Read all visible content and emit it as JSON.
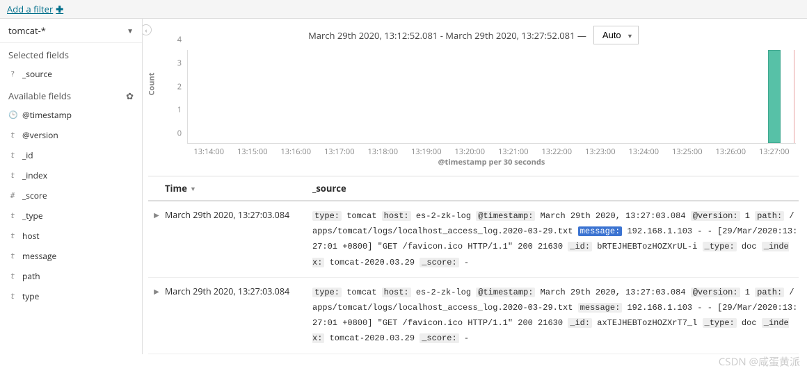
{
  "top": {
    "add_filter": "Add a filter"
  },
  "sidebar": {
    "index_pattern": "tomcat-*",
    "selected_header": "Selected fields",
    "available_header": "Available fields",
    "selected": [
      {
        "type": "?",
        "name": "_source"
      }
    ],
    "available": [
      {
        "type": "clock",
        "name": "@timestamp"
      },
      {
        "type": "t",
        "name": "@version"
      },
      {
        "type": "t",
        "name": "_id"
      },
      {
        "type": "t",
        "name": "_index"
      },
      {
        "type": "#",
        "name": "_score"
      },
      {
        "type": "t",
        "name": "_type"
      },
      {
        "type": "t",
        "name": "host"
      },
      {
        "type": "t",
        "name": "message"
      },
      {
        "type": "t",
        "name": "path"
      },
      {
        "type": "t",
        "name": "type"
      }
    ]
  },
  "timeline": {
    "range_label": "March 29th 2020, 13:12:52.081 - March 29th 2020, 13:27:52.081 —",
    "interval": "Auto"
  },
  "chart_data": {
    "type": "bar",
    "ylabel": "Count",
    "xlabel": "@timestamp per 30 seconds",
    "ylim": [
      0,
      4
    ],
    "y_ticks": [
      0,
      1,
      2,
      3,
      4
    ],
    "x_ticks": [
      "13:14:00",
      "13:15:00",
      "13:16:00",
      "13:17:00",
      "13:18:00",
      "13:19:00",
      "13:20:00",
      "13:21:00",
      "13:22:00",
      "13:23:00",
      "13:24:00",
      "13:25:00",
      "13:26:00",
      "13:27:00"
    ],
    "bars": [
      {
        "x_frac": 0.965,
        "value": 4
      }
    ],
    "end_marker_frac": 0.996
  },
  "table": {
    "headers": {
      "time": "Time",
      "source": "_source"
    },
    "rows": [
      {
        "time": "March 29th 2020, 13:27:03.084",
        "fields": [
          {
            "k": "type:",
            "v": " tomcat "
          },
          {
            "k": "host:",
            "v": " es-2-zk-log "
          },
          {
            "k": "@timestamp:",
            "v": " March 29th 2020, 13:27:03.084 "
          },
          {
            "k": "@version:",
            "v": " 1 "
          },
          {
            "k": "path:",
            "v": " /apps/tomcat/logs/localhost_access_log.2020-03-29.txt "
          },
          {
            "k": "message:",
            "v": " 192.168.1.103 - - [29/Mar/2020:13:27:01 +0800] \"GET /favicon.ico HTTP/1.1\" 200 21630 ",
            "hl": true
          },
          {
            "k": "_id:",
            "v": " bRTEJHEBTozHOZXrUL-i "
          },
          {
            "k": "_type:",
            "v": " doc "
          },
          {
            "k": "_index:",
            "v": " tomcat-2020.03.29 "
          },
          {
            "k": "_score:",
            "v": " - "
          }
        ]
      },
      {
        "time": "March 29th 2020, 13:27:03.084",
        "fields": [
          {
            "k": "type:",
            "v": " tomcat "
          },
          {
            "k": "host:",
            "v": " es-2-zk-log "
          },
          {
            "k": "@timestamp:",
            "v": " March 29th 2020, 13:27:03.084 "
          },
          {
            "k": "@version:",
            "v": " 1 "
          },
          {
            "k": "path:",
            "v": " /apps/tomcat/logs/localhost_access_log.2020-03-29.txt "
          },
          {
            "k": "message:",
            "v": " 192.168.1.103 - - [29/Mar/2020:13:27:01 +0800] \"GET /favicon.ico HTTP/1.1\" 200 21630 "
          },
          {
            "k": "_id:",
            "v": " axTEJHEBTozHOZXrT7_l "
          },
          {
            "k": "_type:",
            "v": " doc "
          },
          {
            "k": "_index:",
            "v": " tomcat-2020.03.29 "
          },
          {
            "k": "_score:",
            "v": " - "
          }
        ]
      }
    ]
  },
  "watermark": "CSDN @咸蛋黄派"
}
